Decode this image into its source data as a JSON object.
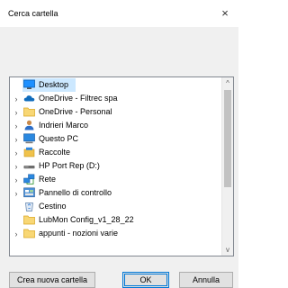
{
  "window": {
    "title": "Cerca cartella",
    "close_glyph": "×"
  },
  "tree": {
    "items": [
      {
        "label": "Desktop",
        "icon": "desktop-icon",
        "expander": "",
        "selected": true
      },
      {
        "label": "OneDrive - Filtrec spa",
        "icon": "onedrive-cloud-icon",
        "expander": "›"
      },
      {
        "label": "OneDrive - Personal",
        "icon": "folder-icon",
        "expander": "›"
      },
      {
        "label": "Indrieri Marco",
        "icon": "user-icon",
        "expander": "›"
      },
      {
        "label": "Questo PC",
        "icon": "computer-icon",
        "expander": "›"
      },
      {
        "label": "Raccolte",
        "icon": "libraries-icon",
        "expander": "›"
      },
      {
        "label": "HP Port Rep (D:)",
        "icon": "drive-icon",
        "expander": "›"
      },
      {
        "label": "Rete",
        "icon": "network-icon",
        "expander": "›"
      },
      {
        "label": "Pannello di controllo",
        "icon": "control-panel-icon",
        "expander": "›"
      },
      {
        "label": "Cestino",
        "icon": "recycle-bin-icon",
        "expander": ""
      },
      {
        "label": "LubMon Config_v1_28_22",
        "icon": "folder-icon",
        "expander": ""
      },
      {
        "label": "appunti - nozioni varie",
        "icon": "folder-icon",
        "expander": "›"
      }
    ],
    "scroll_up_glyph": "^",
    "scroll_down_glyph": "v"
  },
  "buttons": {
    "new_folder": "Crea nuova cartella",
    "ok": "OK",
    "cancel": "Annulla"
  },
  "colors": {
    "selection": "#cce8ff",
    "accent": "#0078d7"
  }
}
